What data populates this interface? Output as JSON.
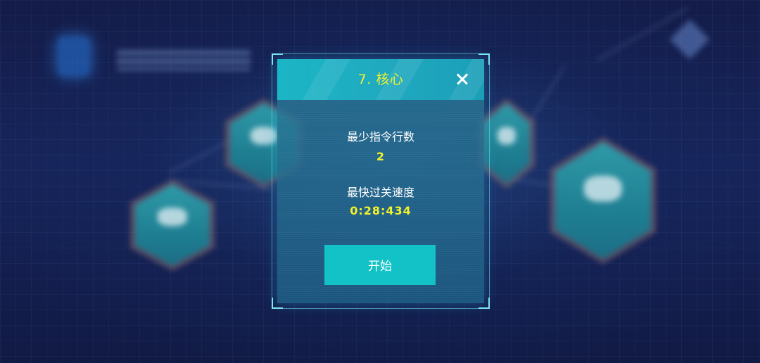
{
  "dialog": {
    "title": "7. 核心",
    "close_icon": "close-icon",
    "min_instructions_label": "最少指令行数",
    "min_instructions_value": "2",
    "fastest_time_label": "最快过关速度",
    "fastest_time_value": "0:28:434",
    "start_button_label": "开始"
  },
  "colors": {
    "accent_yellow": "#f4f22a",
    "header_cyan": "#1bb6c6",
    "button_cyan": "#13c2c6",
    "frame_cyan": "#7fe8f2"
  }
}
